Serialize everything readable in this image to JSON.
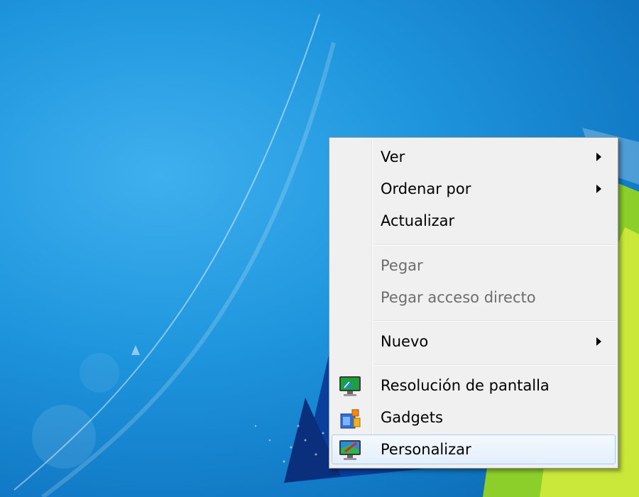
{
  "context_menu": {
    "items": [
      {
        "label": "Ver"
      },
      {
        "label": "Ordenar por"
      },
      {
        "label": "Actualizar"
      },
      {
        "label": "Pegar"
      },
      {
        "label": "Pegar acceso directo"
      },
      {
        "label": "Nuevo"
      },
      {
        "label": "Resolución de pantalla",
        "icon": "monitor-resolution-icon"
      },
      {
        "label": "Gadgets",
        "icon": "gadgets-icon"
      },
      {
        "label": "Personalizar",
        "icon": "personalize-icon"
      }
    ],
    "disabled_items": [
      "Pegar",
      "Pegar acceso directo"
    ],
    "highlighted_item": "Personalizar"
  },
  "colors": {
    "menu_background": "#f0f0f0",
    "highlight_border": "#aaccf0",
    "disabled_text": "#6d6d6d",
    "desktop_blue": "#1e95dd",
    "wallpaper_green": "#8ccf2a"
  }
}
